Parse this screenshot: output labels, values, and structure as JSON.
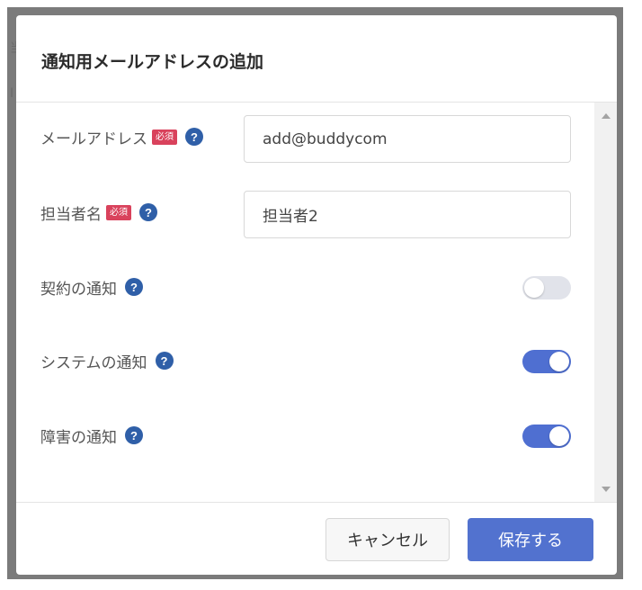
{
  "dialog": {
    "title": "通知用メールアドレスの追加"
  },
  "background": {
    "glyph_top": "当",
    "glyph_mid": "I"
  },
  "fields": {
    "email": {
      "label": "メールアドレス",
      "required_badge": "必須",
      "value": "add@buddycom"
    },
    "person": {
      "label": "担当者名",
      "required_badge": "必須",
      "value": "担当者2"
    }
  },
  "toggles": {
    "contract": {
      "label": "契約の通知",
      "on": false
    },
    "system": {
      "label": "システムの通知",
      "on": true
    },
    "failure": {
      "label": "障害の通知",
      "on": true
    }
  },
  "help_glyph": "?",
  "buttons": {
    "cancel": "キャンセル",
    "save": "保存する"
  },
  "colors": {
    "primary": "#5272cf",
    "toggle_on": "#4f6fd1",
    "toggle_off": "#e1e3ea",
    "required": "#d9425c",
    "help": "#2f5fa8"
  }
}
